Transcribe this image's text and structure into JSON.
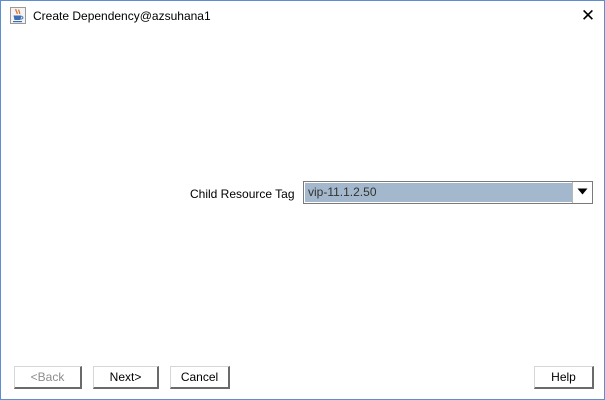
{
  "window": {
    "title": "Create Dependency@azsuhana1",
    "close_glyph": "✕",
    "app_icon": "java-cup-icon"
  },
  "form": {
    "child_resource_tag": {
      "label": "Child Resource Tag",
      "selected_value": "vip-11.1.2.50",
      "dropdown_icon": "triangle-down-icon"
    }
  },
  "buttons": {
    "back": {
      "label": "<Back",
      "enabled": false
    },
    "next": {
      "label": "Next>",
      "enabled": true
    },
    "cancel": {
      "label": "Cancel",
      "enabled": true
    },
    "help": {
      "label": "Help",
      "enabled": true
    }
  },
  "colors": {
    "window_border": "#5b8fcf",
    "selection_bg": "#a3b8cc",
    "disabled_text": "#8c8c8c"
  }
}
